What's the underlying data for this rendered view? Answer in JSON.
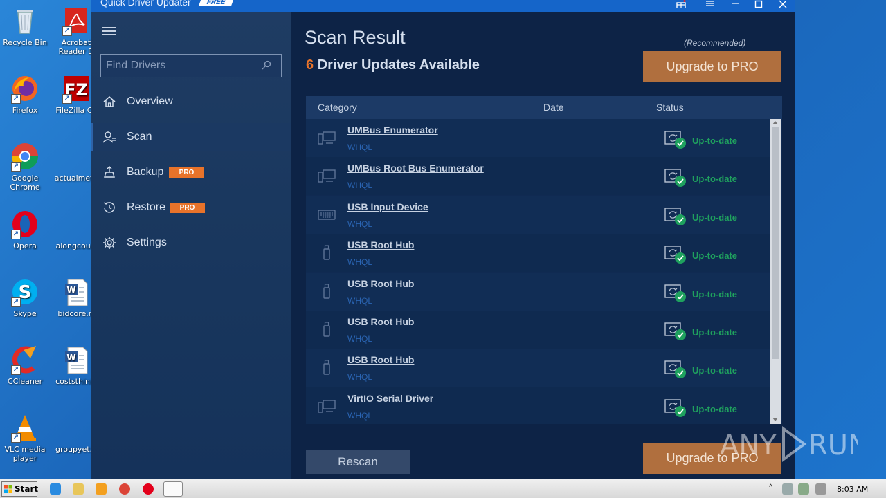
{
  "desktop": {
    "icons": [
      {
        "label": "Recycle Bin",
        "line2": ""
      },
      {
        "label": "Acrobat",
        "line2": "Reader D"
      },
      {
        "label": "Firefox",
        "line2": ""
      },
      {
        "label": "FileZilla Cli",
        "line2": ""
      },
      {
        "label": "Google",
        "line2": "Chrome"
      },
      {
        "label": "actualmeta",
        "line2": ""
      },
      {
        "label": "Opera",
        "line2": ""
      },
      {
        "label": "alongcourt",
        "line2": ""
      },
      {
        "label": "Skype",
        "line2": ""
      },
      {
        "label": "bidcore.rt",
        "line2": ""
      },
      {
        "label": "CCleaner",
        "line2": ""
      },
      {
        "label": "coststhink.",
        "line2": ""
      },
      {
        "label": "VLC media",
        "line2": "player"
      },
      {
        "label": "groupyet.p",
        "line2": ""
      }
    ]
  },
  "app": {
    "title": "Quick Driver Updater",
    "edition_badge": "FREE",
    "sidebar": {
      "search_placeholder": "Find Drivers",
      "items": [
        {
          "label": "Overview",
          "badge": ""
        },
        {
          "label": "Scan",
          "badge": ""
        },
        {
          "label": "Backup",
          "badge": "PRO"
        },
        {
          "label": "Restore",
          "badge": "PRO"
        },
        {
          "label": "Settings",
          "badge": ""
        }
      ]
    },
    "main": {
      "title": "Scan Result",
      "update_count": "6",
      "update_text": "Driver Updates Available",
      "recommended": "(Recommended)",
      "upgrade_label": "Upgrade to PRO",
      "rescan_label": "Rescan",
      "table": {
        "columns": [
          "Category",
          "Date",
          "Status"
        ],
        "rows": [
          {
            "name": "UMBus Enumerator",
            "cert": "WHQL",
            "status": "Up-to-date",
            "icon": "device-icon"
          },
          {
            "name": "UMBus Root Bus Enumerator",
            "cert": "WHQL",
            "status": "Up-to-date",
            "icon": "device-icon"
          },
          {
            "name": "USB Input Device",
            "cert": "WHQL",
            "status": "Up-to-date",
            "icon": "keyboard-icon"
          },
          {
            "name": "USB Root Hub",
            "cert": "WHQL",
            "status": "Up-to-date",
            "icon": "usb-icon"
          },
          {
            "name": "USB Root Hub",
            "cert": "WHQL",
            "status": "Up-to-date",
            "icon": "usb-icon"
          },
          {
            "name": "USB Root Hub",
            "cert": "WHQL",
            "status": "Up-to-date",
            "icon": "usb-icon"
          },
          {
            "name": "USB Root Hub",
            "cert": "WHQL",
            "status": "Up-to-date",
            "icon": "usb-icon"
          },
          {
            "name": "VirtIO Serial Driver",
            "cert": "WHQL",
            "status": "Up-to-date",
            "icon": "device-icon"
          }
        ]
      }
    }
  },
  "watermark": "ANY RUN",
  "taskbar": {
    "start_label": "Start",
    "time": "8:03 AM"
  },
  "colors": {
    "accent_orange": "#e8732a",
    "status_green": "#1fa15e",
    "upgrade_button": "#b06f3e"
  }
}
